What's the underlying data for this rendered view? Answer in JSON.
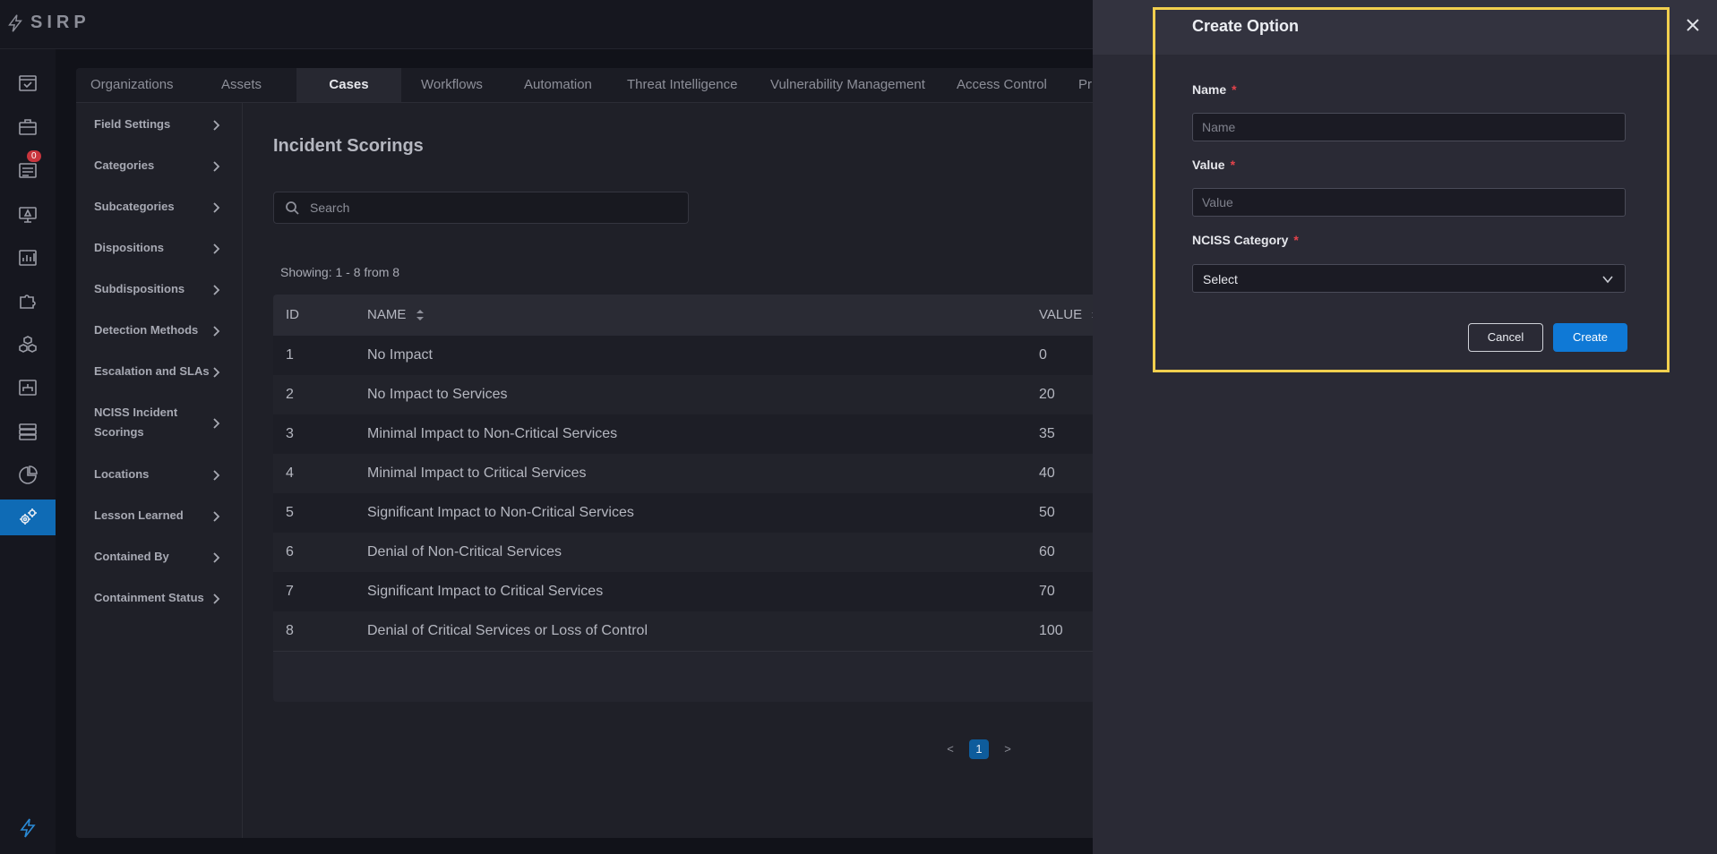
{
  "app": {
    "logo_text": "SIRP"
  },
  "rail": {
    "notification_count": "0"
  },
  "tabs": [
    "Organizations",
    "Assets",
    "Cases",
    "Workflows",
    "Automation",
    "Threat Intelligence",
    "Vulnerability Management",
    "Access Control",
    "Pr"
  ],
  "active_tab": "Cases",
  "sidebar": {
    "items": [
      "Field Settings",
      "Categories",
      "Subcategories",
      "Dispositions",
      "Subdispositions",
      "Detection Methods",
      "Escalation and SLAs",
      "NCISS Incident Scorings",
      "Locations",
      "Lesson Learned",
      "Contained By",
      "Containment Status"
    ]
  },
  "page": {
    "title": "Incident Scorings",
    "search_placeholder": "Search",
    "showing": "Showing: 1 - 8 from 8"
  },
  "table": {
    "headers": {
      "id": "ID",
      "name": "NAME",
      "value": "VALUE"
    },
    "rows": [
      {
        "id": "1",
        "name": "No Impact",
        "value": "0"
      },
      {
        "id": "2",
        "name": "No Impact to Services",
        "value": "20"
      },
      {
        "id": "3",
        "name": "Minimal Impact to Non-Critical Services",
        "value": "35"
      },
      {
        "id": "4",
        "name": "Minimal Impact to Critical Services",
        "value": "40"
      },
      {
        "id": "5",
        "name": "Significant Impact to Non-Critical Services",
        "value": "50"
      },
      {
        "id": "6",
        "name": "Denial of Non-Critical Services",
        "value": "60"
      },
      {
        "id": "7",
        "name": "Significant Impact to Critical Services",
        "value": "70"
      },
      {
        "id": "8",
        "name": "Denial of Critical Services or Loss of Control",
        "value": "100"
      }
    ]
  },
  "pagination": {
    "current": "1",
    "prev": "<",
    "next": ">"
  },
  "drawer": {
    "title": "Create Option",
    "name_label": "Name",
    "name_placeholder": "Name",
    "value_label": "Value",
    "value_placeholder": "Value",
    "category_label": "NCISS Category",
    "category_selected": "Select",
    "required_mark": "*",
    "cancel_label": "Cancel",
    "create_label": "Create"
  },
  "colors": {
    "accent": "#0f79d6",
    "highlight": "#f1cf4e",
    "active_rail": "#0f6bb5",
    "required": "#e4434b"
  }
}
